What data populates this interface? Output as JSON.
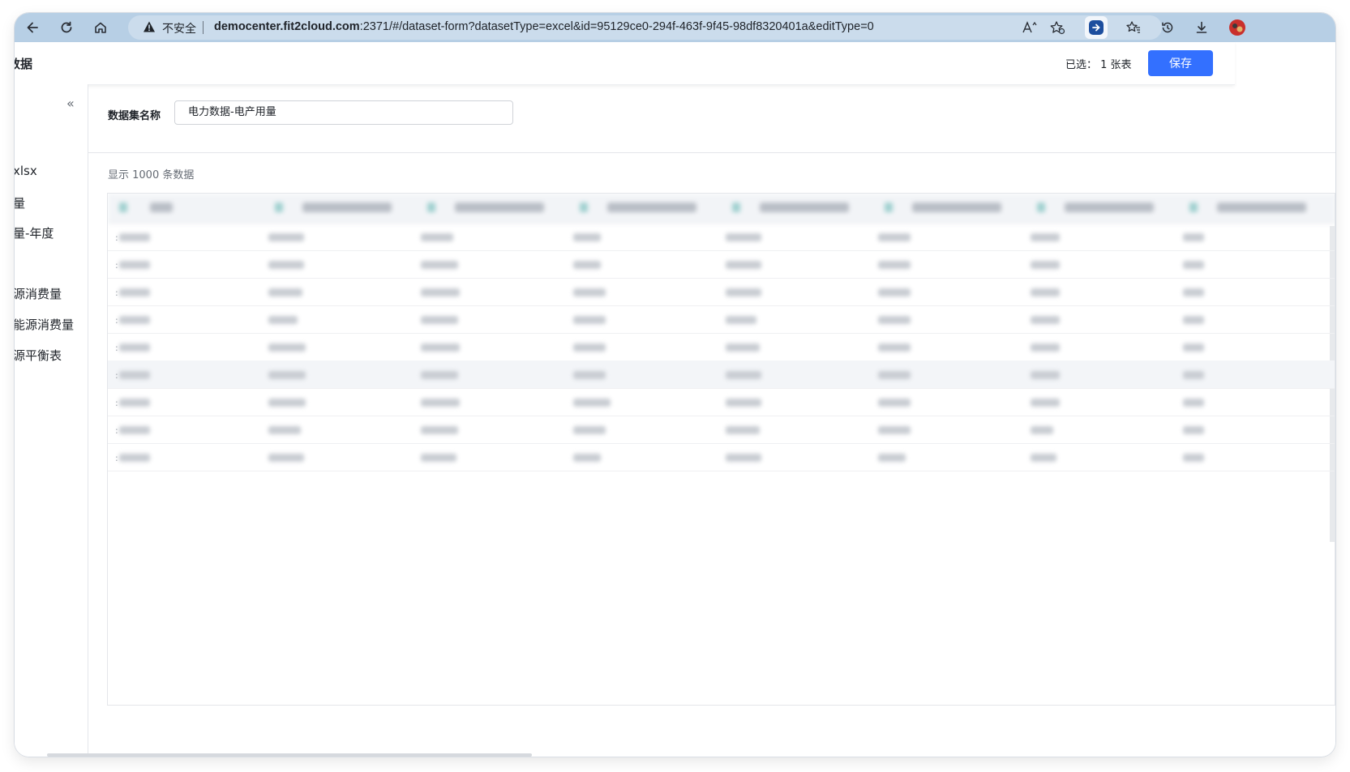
{
  "browser": {
    "insecure_label": "不安全",
    "url_host": "democenter.fit2cloud.com",
    "url_rest": ":2371/#/dataset-form?datasetType=excel&id=95129ce0-294f-463f-9f45-98df8320401a&editType=0"
  },
  "header": {
    "title": "数据",
    "selected_label": "已选：",
    "selected_value": "1 张表",
    "save_label": "保存"
  },
  "sidebar": {
    "collapse_glyph": "«",
    "items": [
      {
        "label": "xlsx"
      },
      {
        "label": "量"
      },
      {
        "label": "量-年度"
      },
      {
        "label": "源消费量"
      },
      {
        "label": "能源消费量"
      },
      {
        "label": "源平衡表"
      }
    ]
  },
  "form": {
    "name_label": "数据集名称",
    "name_value": "电力数据-电产用量"
  },
  "table": {
    "count_label": "显示 1000 条数据",
    "row_count": 9,
    "highlighted_row": 6
  }
}
